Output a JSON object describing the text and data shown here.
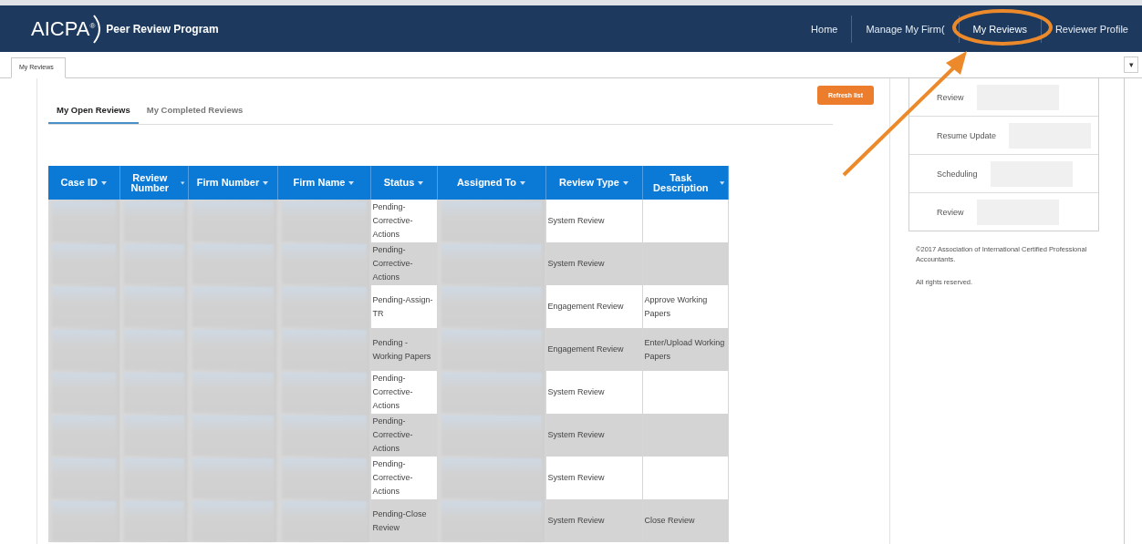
{
  "header": {
    "logo": "AICPA$^{®}$",
    "program": "Peer Review Program",
    "nav": [
      {
        "label": "Home",
        "selected": false
      },
      {
        "label": "Manage My Firm(",
        "selected": false
      },
      {
        "label": "My Reviews",
        "selected": true
      },
      {
        "label": "Reviewer Profile",
        "selected": false
      }
    ]
  },
  "page_tab": {
    "label": "My Reviews",
    "menu": "▾"
  },
  "subtabs": [
    {
      "label": "My Open Reviews",
      "selected": true
    },
    {
      "label": "My Completed Reviews",
      "selected": false
    }
  ],
  "refresh_button": "Refresh list",
  "table": {
    "columns": [
      "Case ID",
      "Review Number",
      "Firm Number",
      "Firm Name",
      "Status",
      "Assigned To",
      "Review Type",
      "Task Description"
    ],
    "rows": [
      {
        "status": "Pending-Corrective-Actions",
        "review_type": "System Review",
        "task": ""
      },
      {
        "status": "Pending-Corrective-Actions",
        "review_type": "System Review",
        "task": ""
      },
      {
        "status": "Pending-Assign-TR",
        "review_type": "Engagement Review",
        "task": "Approve Working Papers"
      },
      {
        "status": "Pending - Working Papers",
        "review_type": "Engagement Review",
        "task": "Enter/Upload Working Papers"
      },
      {
        "status": "Pending-Corrective-Actions",
        "review_type": "System Review",
        "task": ""
      },
      {
        "status": "Pending-Corrective-Actions",
        "review_type": "System Review",
        "task": ""
      },
      {
        "status": "Pending-Corrective-Actions",
        "review_type": "System Review",
        "task": ""
      },
      {
        "status": "Pending-Close Review",
        "review_type": "System Review",
        "task": "Close Review"
      }
    ]
  },
  "side_list": [
    {
      "label": "Review"
    },
    {
      "label": "Resume Update"
    },
    {
      "label": "Scheduling"
    },
    {
      "label": "Review"
    }
  ],
  "footer": {
    "copyright": "©2017 Association of International Certified Professional Accountants.",
    "rights": "All rights reserved."
  }
}
